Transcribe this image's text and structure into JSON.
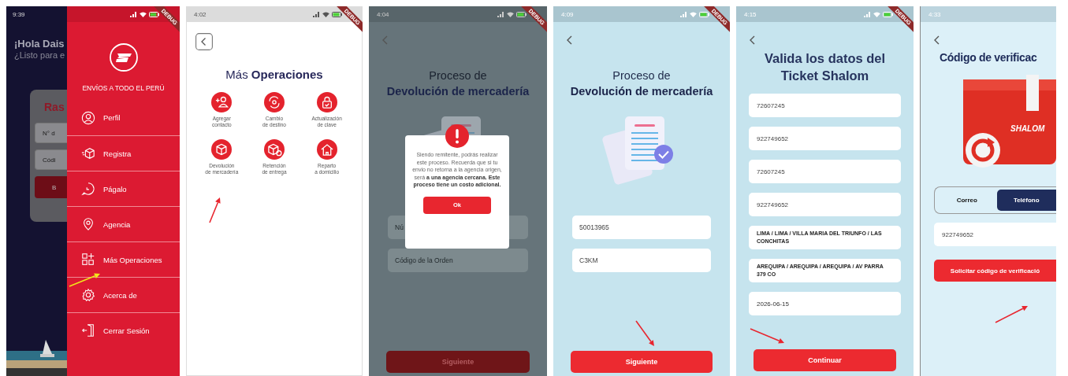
{
  "screens": [
    {
      "kind": "drawer",
      "status_bar": {
        "time": "9:39"
      },
      "debug_banner": "DEBUG",
      "annotation_arrow": {
        "color": "#f2e51b"
      },
      "home": {
        "greeting": "¡Hola Dais",
        "subtitle": "¿Listo para e",
        "card_title": "Ras",
        "fields": [
          {
            "placeholder": "N° d"
          },
          {
            "placeholder": "Códi"
          }
        ],
        "button": "B"
      },
      "drawer": {
        "tagline": "ENVÍOS A TODO EL PERÚ",
        "items": [
          {
            "label": "Perfil"
          },
          {
            "label": "Registra"
          },
          {
            "label": "Págalo"
          },
          {
            "label": "Agencia"
          },
          {
            "label": "Más Operaciones"
          },
          {
            "label": "Acerca de"
          },
          {
            "label": "Cerrar Sesión"
          }
        ]
      }
    },
    {
      "kind": "operations",
      "status_bar": {
        "time": "4:02"
      },
      "debug_banner": "DEBUG",
      "annotation_arrow": {
        "color": "#e8262f"
      },
      "title": "Más **Operaciones**",
      "operations": [
        {
          "label": "Agregar\ncontacto"
        },
        {
          "label": "Cambio\nde destino"
        },
        {
          "label": "Actualización\nde clave"
        },
        {
          "label": "Devolución\nde mercadería"
        },
        {
          "label": "Retención\nde entrega"
        },
        {
          "label": "Reparto\na domicilio"
        }
      ]
    },
    {
      "kind": "dialog",
      "status_bar": {
        "time": "4:04"
      },
      "debug_banner": "DEBUG",
      "title_lines": [
        "Proceso de",
        "Devolución de mercadería"
      ],
      "fields": [
        {
          "placeholder": "Nú"
        },
        {
          "placeholder": "Código de la Orden"
        }
      ],
      "button": "Siguiente",
      "dialog": {
        "message": "Siendo remitente, podrás realizar este proceso. Recuerda que si tu envio no retorna a la agencia origen, será **a una agencia cercana. Este proceso tiene un costo adicional.**",
        "button": "Ok"
      }
    },
    {
      "kind": "form",
      "status_bar": {
        "time": "4:09"
      },
      "debug_banner": "DEBUG",
      "annotation_arrow": {
        "color": "#e8262f"
      },
      "title_lines": [
        "Proceso de",
        "Devolución de mercadería"
      ],
      "fields": [
        {
          "value": "50013965"
        },
        {
          "value": "C3KM"
        }
      ],
      "button": "Siguiente"
    },
    {
      "kind": "ticket",
      "status_bar": {
        "time": "4:15"
      },
      "debug_banner": "DEBUG",
      "annotation_arrow": {
        "color": "#e8262f"
      },
      "title": "Valida los datos del Ticket Shalom",
      "fields": [
        {
          "kind": "plain",
          "value": "72607245"
        },
        {
          "kind": "plain",
          "value": "922749652"
        },
        {
          "kind": "plain",
          "value": "72607245"
        },
        {
          "kind": "plain",
          "value": "922749652"
        },
        {
          "kind": "address",
          "value": "LIMA / LIMA / VILLA MARIA DEL TRIUNFO / LAS CONCHITAS"
        },
        {
          "kind": "address",
          "value": "AREQUIPA / AREQUIPA / AREQUIPA / AV PARRA 379 CO"
        },
        {
          "kind": "date",
          "value": "2026-06-15"
        }
      ],
      "button": "Continuar"
    },
    {
      "kind": "verification",
      "status_bar": {
        "time": "4:33"
      },
      "annotation_arrow": {
        "color": "#e8262f"
      },
      "title": "Código de verificac",
      "box_label": "SHALOM",
      "options": [
        {
          "label": "Correo",
          "selected": false
        },
        {
          "label": "Teléfono",
          "selected": true
        }
      ],
      "field": {
        "value": "922749652"
      },
      "button": "Solicitar código de verificació"
    }
  ]
}
